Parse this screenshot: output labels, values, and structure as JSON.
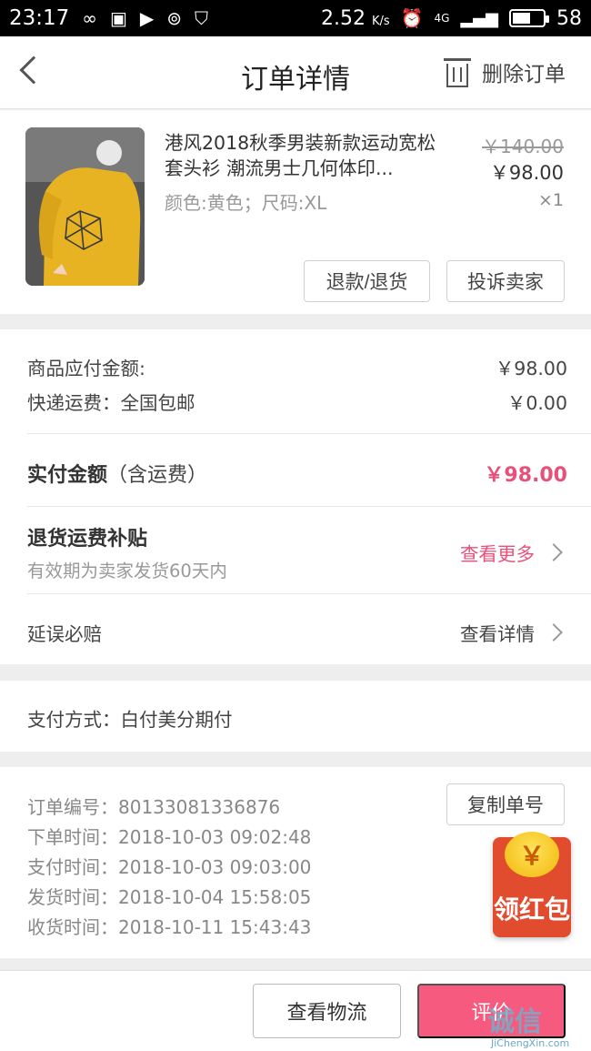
{
  "status_bar": {
    "time": "23:17",
    "speed": "2.52",
    "speed_unit": "K/s",
    "network": "4G",
    "battery": "58",
    "battery_level": 0.58
  },
  "header": {
    "title": "订单详情",
    "delete_label": "删除订单"
  },
  "product": {
    "title": "港风2018秋季男装新款运动宽松套头衫 潮流男士几何体印...",
    "spec": "颜色:黄色；尺码:XL",
    "original_price": "￥140.00",
    "price": "￥98.00",
    "quantity": "×1",
    "refund_label": "退款/退货",
    "complain_label": "投诉卖家"
  },
  "amounts": {
    "goods_label": "商品应付金额:",
    "goods_value": "￥98.00",
    "shipping_label": "快递运费：全国包邮",
    "shipping_value": "￥0.00",
    "paid_label": "实付金额",
    "paid_note": "（含运费）",
    "paid_value": "￥98.00",
    "return_title": "退货运费补贴",
    "return_desc": "有效期为卖家发货60天内",
    "return_link": "查看更多",
    "delay_label": "延误必赔",
    "delay_link": "查看详情"
  },
  "payment_method": "支付方式：白付美分期付",
  "order_info": {
    "order_no": "订单编号：80133081336876",
    "order_time": "下单时间：2018-10-03  09:02:48",
    "pay_time": "支付时间：2018-10-03  09:03:00",
    "ship_time": "发货时间：2018-10-04  15:58:05",
    "receive_time": "收货时间：2018-10-11  15:43:43",
    "copy_label": "复制单号"
  },
  "red_packet": {
    "coin_symbol": "￥",
    "label": "领红包"
  },
  "bottom_bar": {
    "logistics_label": "查看物流",
    "review_label": "评价"
  },
  "watermark": {
    "text": "诚信",
    "url": "JiChengXin.com"
  },
  "colors": {
    "accent": "#e8507a",
    "review_button": "#f65a7f",
    "red_packet": "#e14b2e"
  }
}
